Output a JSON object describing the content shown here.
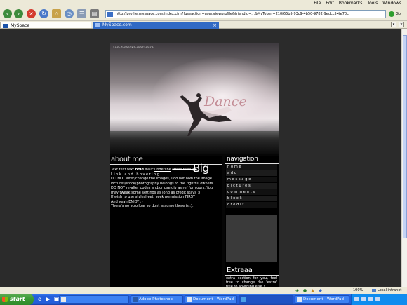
{
  "browser": {
    "menus": [
      "File",
      "Edit",
      "Bookmarks",
      "Tools",
      "Windows"
    ],
    "address": "http://profile.myspace.com/index.cfm?fuseaction=user.viewprofile&friendid=...&MyToken=210f65b5-93c9-4b50-9782-9edcc54fe70c",
    "go_label": "Go",
    "tabs": [
      {
        "label": "MySpace",
        "active": false
      },
      {
        "label": "MySpace.com",
        "active": true
      }
    ]
  },
  "profile": {
    "banner_caption": "ann-d-saroka-mozamira",
    "banner_word": "Dance",
    "about": {
      "title": "about me",
      "big": "Big",
      "line1": {
        "plain": "Text text text",
        "bold": "bold",
        "italic": "italic",
        "underline": "underline",
        "strike": "strike-through"
      },
      "line2": "Link and hovering",
      "lines": [
        "DO NOT alter/change the images, I do not own the image.",
        "Pictures/stock/photography belongs to the rightful owners.",
        "DO NOT re-alter codes and/or use div as ref for yours. You",
        "may tweak some settings as long as credit stays :)",
        "If wish to use stylesheet, seek permission FIRST",
        "And yeah ENJOY :)",
        "There's no scrollbar so dont assume there is :)."
      ]
    },
    "navigation": {
      "title": "navigation",
      "items": [
        "home",
        "add",
        "message",
        "pictures",
        "comments",
        "block",
        "credit"
      ]
    },
    "extra": {
      "title": "Extraaa",
      "text": "extra section for you, feel free to change the 'extra' title to anything else !"
    }
  },
  "status": {
    "zoom": "100%",
    "zone": "Local intranet"
  },
  "taskbar": {
    "start": "start",
    "tasks": [
      {
        "label": "",
        "active": false
      },
      {
        "label": "Adobe Photoshop",
        "active": false
      },
      {
        "label": "Document - WordPad",
        "active": false
      },
      {
        "label": "",
        "active": true
      },
      {
        "label": "Document - WordPad",
        "active": false
      }
    ]
  },
  "colors": {
    "page_background": "#2b2b2b",
    "column_background": "#060606",
    "taskbar_blue": "#245edb",
    "start_green": "#3c9c35",
    "banner_word": "#be828c"
  },
  "icons": {
    "toolbar": [
      "back-icon",
      "forward-icon",
      "stop-icon",
      "reload-icon",
      "home-icon",
      "history-icon",
      "bookmarks-icon",
      "print-icon"
    ],
    "status": [
      "security-icon",
      "cookie-icon",
      "warning-icon",
      "info-icon"
    ]
  }
}
